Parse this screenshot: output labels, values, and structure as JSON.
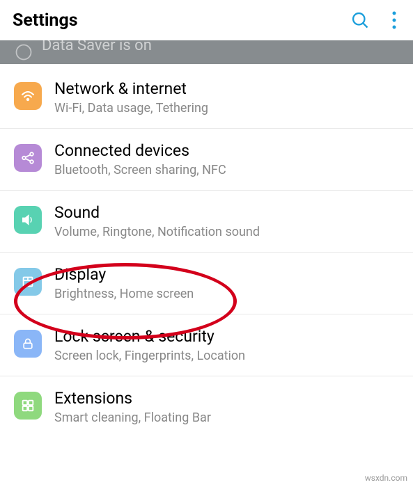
{
  "header": {
    "title": "Settings"
  },
  "banner": {
    "text": "Data Saver is on"
  },
  "items": [
    {
      "title": "Network & internet",
      "subtitle": "Wi-Fi, Data usage, Tethering",
      "iconBg": "#f7a94d",
      "iconName": "wifi-icon"
    },
    {
      "title": "Connected devices",
      "subtitle": "Bluetooth, Screen sharing, NFC",
      "iconBg": "#b68ad6",
      "iconName": "share-icon"
    },
    {
      "title": "Sound",
      "subtitle": "Volume, Ringtone, Notification sound",
      "iconBg": "#58d2b2",
      "iconName": "speaker-icon"
    },
    {
      "title": "Display",
      "subtitle": "Brightness, Home screen",
      "iconBg": "#84c9e8",
      "iconName": "display-icon"
    },
    {
      "title": "Lock screen & security",
      "subtitle": "Screen lock, Fingerprints, Location",
      "iconBg": "#8ab6f7",
      "iconName": "lock-icon"
    },
    {
      "title": "Extensions",
      "subtitle": "Smart cleaning, Floating Bar",
      "iconBg": "#8fd97e",
      "iconName": "extension-icon"
    }
  ],
  "watermark": "wsxdn.com"
}
